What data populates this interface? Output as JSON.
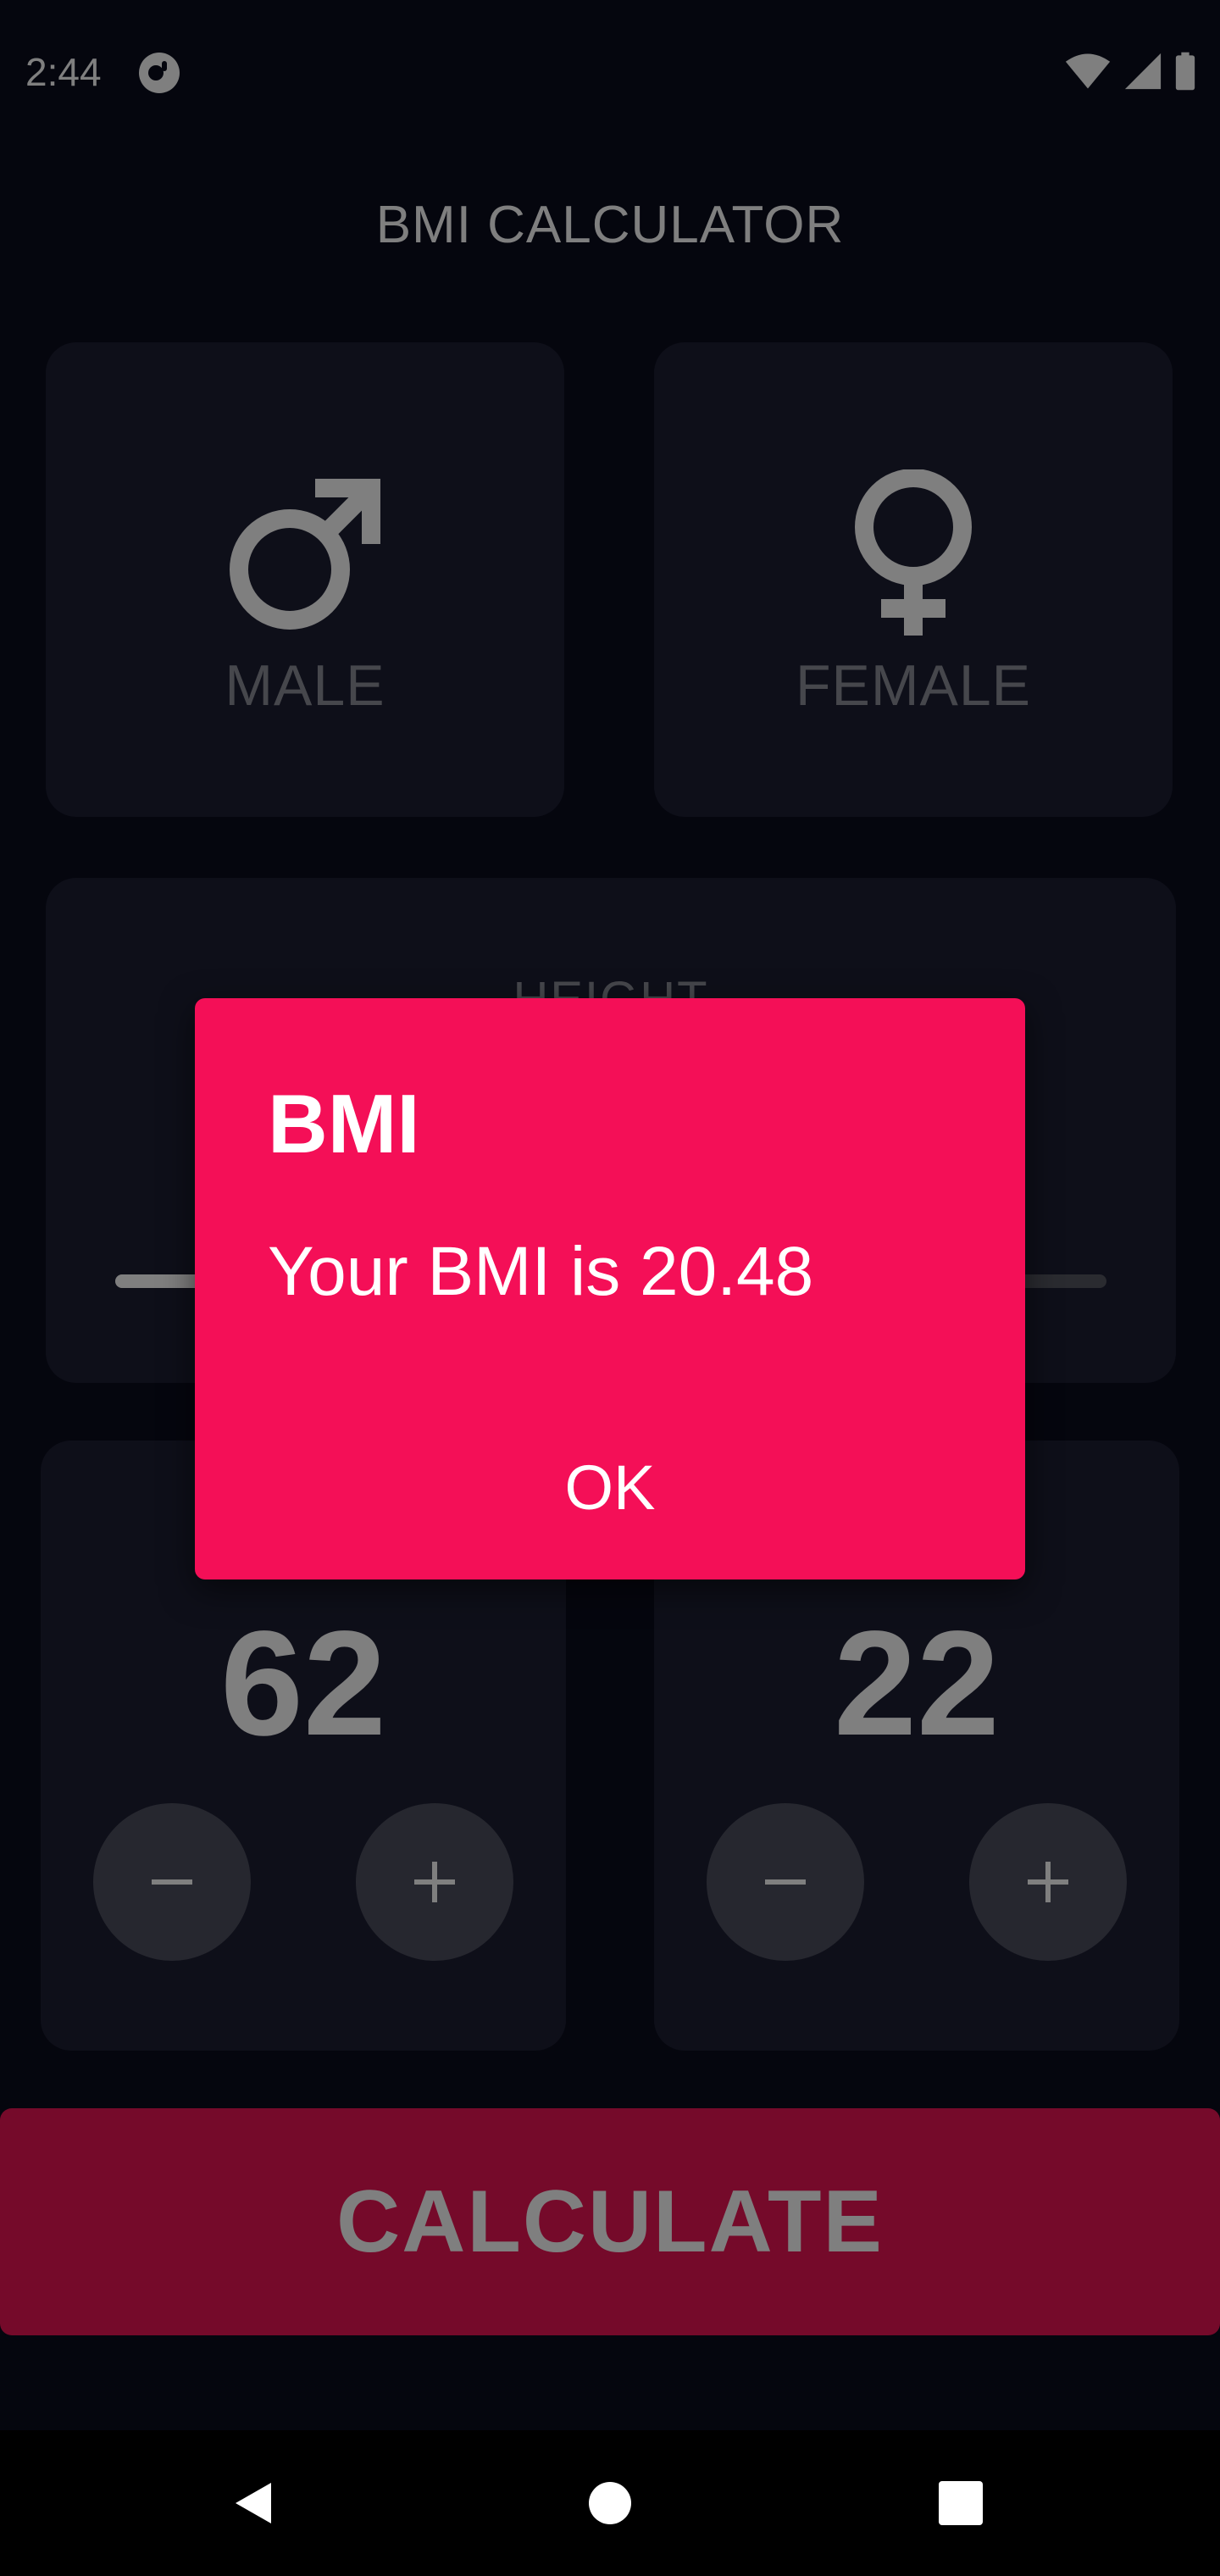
{
  "status_bar": {
    "time": "2:44",
    "icons": [
      "app-notification-icon",
      "wifi-icon",
      "cellular-signal-icon",
      "battery-icon"
    ]
  },
  "app_bar": {
    "title": "BMI CALCULATOR"
  },
  "gender": {
    "male_label": "MALE",
    "female_label": "FEMALE",
    "male_icon": "male-symbol-icon",
    "female_icon": "female-symbol-icon"
  },
  "height": {
    "label": "HEIGHT",
    "slider_fraction": 0.5
  },
  "weight": {
    "value": "62",
    "minus_icon": "minus-icon",
    "plus_icon": "plus-icon"
  },
  "age": {
    "value": "22",
    "minus_icon": "minus-icon",
    "plus_icon": "plus-icon"
  },
  "calculate": {
    "label": "CALCULATE"
  },
  "dialog": {
    "title": "BMI",
    "message": "Your BMI is 20.48",
    "ok_label": "OK"
  },
  "navigation": {
    "icons": [
      "back-icon",
      "home-icon",
      "recents-icon"
    ]
  },
  "colors": {
    "background": "#0a0c1d",
    "card": "#1d1e33",
    "accent": "#eb1555",
    "dialog": "#f40f57",
    "label": "#8d8e98"
  }
}
